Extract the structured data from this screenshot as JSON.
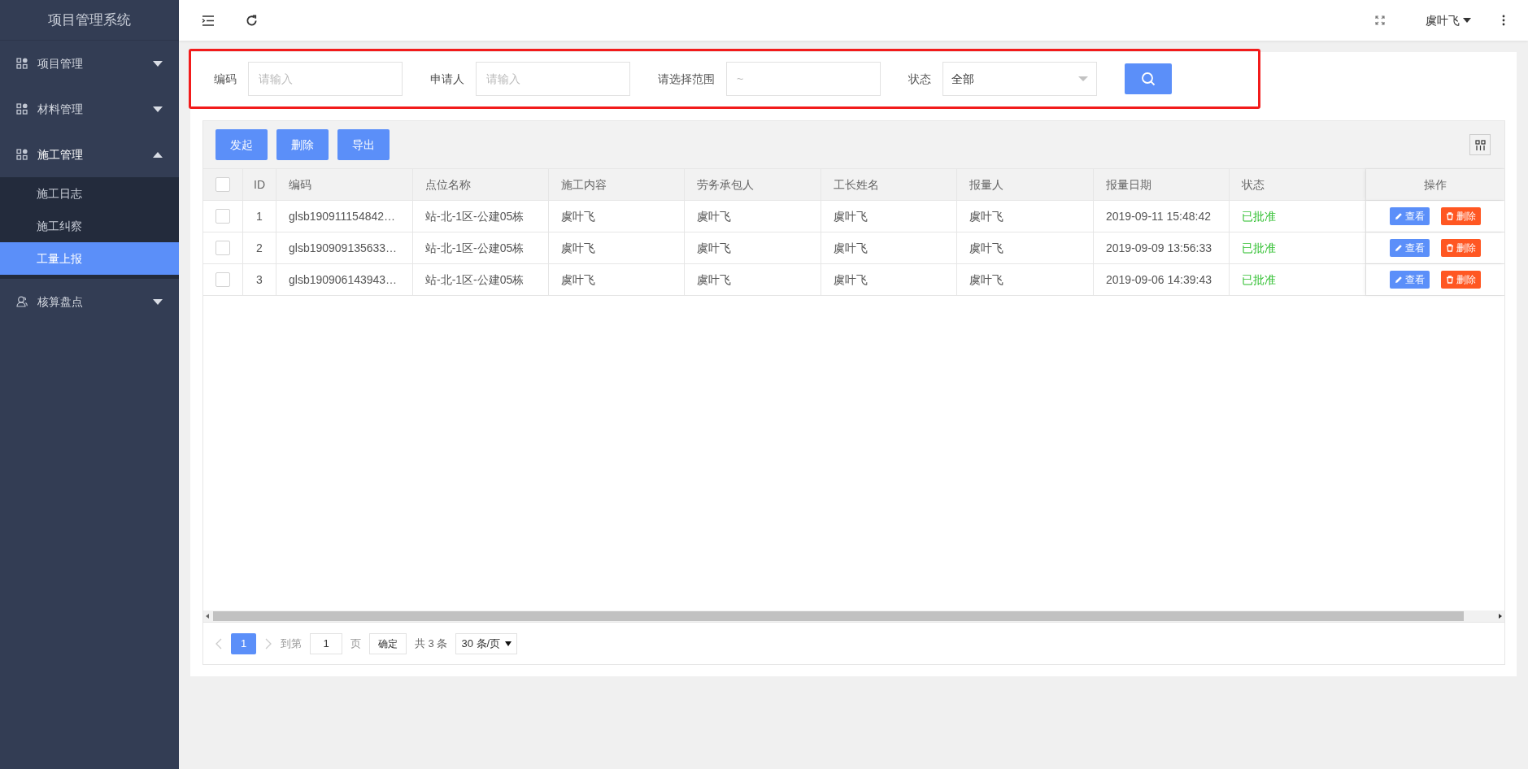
{
  "sidebar": {
    "title": "项目管理系统",
    "menu": [
      {
        "label": "项目管理",
        "kind": "grid",
        "expanded": false
      },
      {
        "label": "材料管理",
        "kind": "grid",
        "expanded": false
      },
      {
        "label": "施工管理",
        "kind": "grid",
        "expanded": true,
        "children": [
          {
            "label": "施工日志",
            "selected": false
          },
          {
            "label": "施工纠察",
            "selected": false
          },
          {
            "label": "工量上报",
            "selected": true
          }
        ]
      },
      {
        "label": "核算盘点",
        "kind": "user",
        "expanded": false
      }
    ]
  },
  "header": {
    "user": "虞叶飞"
  },
  "filters": [
    {
      "label": "编码",
      "kind": "input",
      "placeholder": "请输入"
    },
    {
      "label": "申请人",
      "kind": "input",
      "placeholder": "请输入"
    },
    {
      "label": "请选择范围",
      "kind": "range",
      "placeholder": "~"
    },
    {
      "label": "状态",
      "kind": "select",
      "value": "全部"
    }
  ],
  "toolbar": [
    "发起",
    "删除",
    "导出"
  ],
  "table": {
    "select_all_checked": false,
    "columns": [
      "ID",
      "编码",
      "点位名称",
      "施工内容",
      "劳务承包人",
      "工长姓名",
      "报量人",
      "报量日期",
      "状态",
      "操作"
    ],
    "rows": [
      {
        "checked": false,
        "cells": [
          "1",
          "glsb190911154842…",
          "站-北-1区-公建05栋",
          "虞叶飞",
          "虞叶飞",
          "虞叶飞",
          "虞叶飞",
          "2019-09-11 15:48:42",
          "已批准"
        ],
        "actions": [
          "查看",
          "删除"
        ]
      },
      {
        "checked": false,
        "cells": [
          "2",
          "glsb190909135633…",
          "站-北-1区-公建05栋",
          "虞叶飞",
          "虞叶飞",
          "虞叶飞",
          "虞叶飞",
          "2019-09-09 13:56:33",
          "已批准"
        ],
        "actions": [
          "查看",
          "删除"
        ]
      },
      {
        "checked": false,
        "cells": [
          "3",
          "glsb190906143943…",
          "站-北-1区-公建05栋",
          "虞叶飞",
          "虞叶飞",
          "虞叶飞",
          "虞叶飞",
          "2019-09-06 14:39:43",
          "已批准"
        ],
        "actions": [
          "查看",
          "删除"
        ]
      }
    ]
  },
  "pager": {
    "pages": [
      {
        "label": "1",
        "selected": true
      }
    ],
    "goto_label": "到第",
    "goto_value": "1",
    "page_unit": "页",
    "confirm": "确定",
    "total": "共 3 条",
    "page_size": "30 条/页"
  }
}
